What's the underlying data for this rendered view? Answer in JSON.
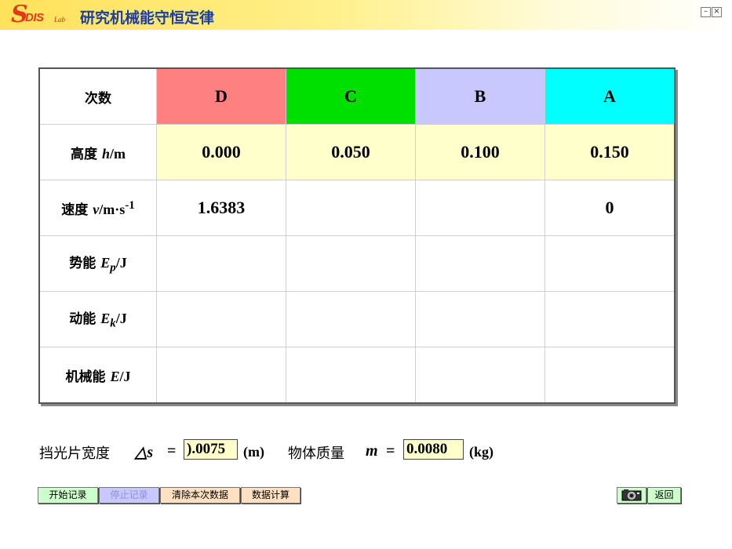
{
  "app": {
    "logo_s": "S",
    "logo_text": "DIS",
    "logo_sub": "Lab",
    "title": "研究机械能守恒定律",
    "window_minimize": "–",
    "window_close": "×"
  },
  "table": {
    "header_label": "次数",
    "columns": [
      {
        "label": "D",
        "color": "#ff8080"
      },
      {
        "label": "C",
        "color": "#00e000"
      },
      {
        "label": "B",
        "color": "#c8c8ff"
      },
      {
        "label": "A",
        "color": "#00ffff"
      }
    ],
    "rows": [
      {
        "label_cn": "高度 ",
        "label_var": "h",
        "label_unit": "/m",
        "values": [
          "0.000",
          "0.050",
          "0.100",
          "0.150"
        ]
      },
      {
        "label_cn": "速度 ",
        "label_var": "v",
        "label_unit": "/m·s",
        "label_sup": "-1",
        "values": [
          "1.6383",
          "",
          "",
          "0"
        ]
      },
      {
        "label_cn": "势能 ",
        "label_var": "E",
        "label_sub": "p",
        "label_unit": "/J",
        "values": [
          "",
          "",
          "",
          ""
        ]
      },
      {
        "label_cn": "动能 ",
        "label_var": "E",
        "label_sub": "k",
        "label_unit": "/J",
        "values": [
          "",
          "",
          "",
          ""
        ]
      },
      {
        "label_cn": "机械能 ",
        "label_var": "E",
        "label_unit": "/J",
        "values": [
          "",
          "",
          "",
          ""
        ]
      }
    ]
  },
  "params": {
    "width_label": "挡光片宽度",
    "width_symbol": "△s",
    "width_eq": "=",
    "width_value": ").0075",
    "width_unit": "(m)",
    "mass_label": "物体质量",
    "mass_symbol": "m",
    "mass_eq": "=",
    "mass_value": "0.0080",
    "mass_unit": "(kg)"
  },
  "buttons": {
    "start": "开始记录",
    "stop": "停止记录",
    "clear": "清除本次数据",
    "compute": "数据计算",
    "back": "返回"
  },
  "colors": {
    "button_green": "#ccffcc",
    "button_lavender": "#c8c8ff",
    "button_peach": "#ffe0c0",
    "height_row": "#ffffcc"
  }
}
